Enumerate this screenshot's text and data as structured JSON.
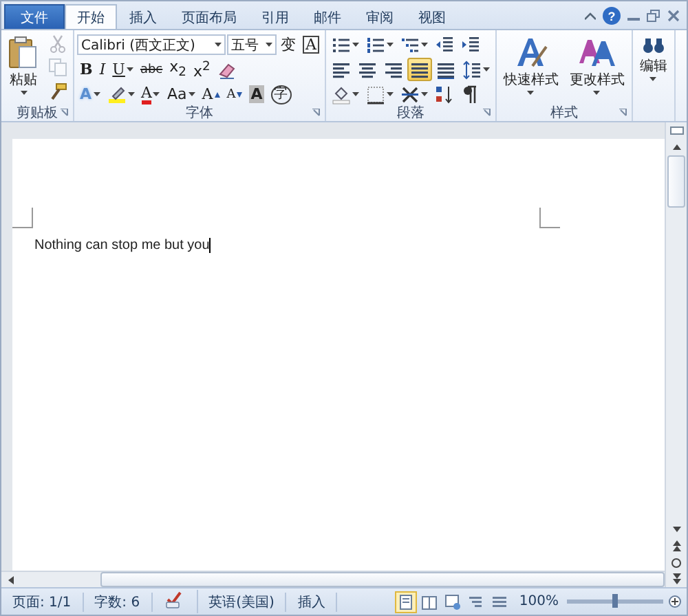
{
  "tabs": [
    {
      "label": "文件",
      "kind": "file",
      "selected": false
    },
    {
      "label": "开始",
      "kind": "tab",
      "selected": true
    },
    {
      "label": "插入",
      "kind": "tab",
      "selected": false
    },
    {
      "label": "页面布局",
      "kind": "tab",
      "selected": false
    },
    {
      "label": "引用",
      "kind": "tab",
      "selected": false
    },
    {
      "label": "邮件",
      "kind": "tab",
      "selected": false
    },
    {
      "label": "审阅",
      "kind": "tab",
      "selected": false
    },
    {
      "label": "视图",
      "kind": "tab",
      "selected": false
    }
  ],
  "help": "?",
  "ribbon": {
    "clipboard": {
      "label": "剪贴板",
      "paste": "粘贴",
      "tools": [
        {
          "kind": "cut",
          "disabled": true
        },
        {
          "kind": "copy",
          "disabled": true
        },
        {
          "kind": "painter",
          "disabled": false
        }
      ]
    },
    "font": {
      "label": "字体",
      "font_name": "Calibri (西文正文)",
      "font_size": "五号",
      "tool_rows": [
        {
          "tools": [
            {
              "kind": "phonetic",
              "text": "变"
            },
            {
              "kind": "border",
              "text": "A"
            }
          ]
        },
        {
          "tools": [
            {
              "kind": "bold",
              "text": "B"
            },
            {
              "kind": "italic",
              "text": "I"
            },
            {
              "kind": "underline",
              "text": "U"
            },
            {
              "kind": "strike",
              "text": "abc"
            },
            {
              "kind": "sub",
              "text": "x$_{2}$"
            },
            {
              "kind": "sup",
              "text": "x$^{2}$"
            },
            {
              "kind": "clear"
            }
          ]
        },
        {
          "tools": [
            {
              "kind": "effect",
              "text": "A"
            },
            {
              "kind": "highlight"
            },
            {
              "kind": "color",
              "text": "A"
            },
            {
              "kind": "case",
              "text": "Aa"
            },
            {
              "kind": "grow",
              "text": "A"
            },
            {
              "kind": "shrink",
              "text": "A"
            },
            {
              "kind": "shading",
              "text": "A"
            },
            {
              "kind": "enclose",
              "text": "字"
            }
          ]
        }
      ]
    },
    "paragraph": {
      "label": "段落",
      "tool_rows": [
        {
          "tools": [
            {
              "kind": "bullets"
            },
            {
              "kind": "numbering"
            },
            {
              "kind": "multilevel"
            },
            {
              "kind": "outdent"
            },
            {
              "kind": "indent"
            }
          ]
        },
        {
          "tools": [
            {
              "kind": "left",
              "selected": false
            },
            {
              "kind": "center",
              "selected": false
            },
            {
              "kind": "right",
              "selected": false
            },
            {
              "kind": "justify",
              "selected": true
            },
            {
              "kind": "distribute",
              "selected": false
            },
            {
              "kind": "spacing",
              "selected": false
            }
          ]
        },
        {
          "tools": [
            {
              "kind": "fill"
            },
            {
              "kind": "borders"
            },
            {
              "kind": "asian"
            },
            {
              "kind": "sort"
            },
            {
              "kind": "marks"
            }
          ]
        }
      ]
    },
    "styles": {
      "label": "样式",
      "buttons": [
        {
          "kind": "quick",
          "label": "快速样式"
        },
        {
          "kind": "change",
          "label": "更改样式"
        }
      ]
    },
    "editing": {
      "label": "编辑"
    }
  },
  "document": {
    "text": "Nothing can stop me but you"
  },
  "status_bar": {
    "items": [
      {
        "kind": "text",
        "text": "页面: 1/1"
      },
      {
        "kind": "text",
        "text": "字数: 6"
      },
      {
        "kind": "proofing"
      },
      {
        "kind": "text",
        "text": "英语(美国)"
      },
      {
        "kind": "text",
        "text": "插入"
      }
    ],
    "views": [
      {
        "kind": "print",
        "selected": true
      },
      {
        "kind": "reading",
        "selected": false
      },
      {
        "kind": "web",
        "selected": false
      },
      {
        "kind": "outline",
        "selected": false
      },
      {
        "kind": "draft",
        "selected": false
      }
    ],
    "zoom": "100%",
    "zoom_slider": {
      "level": 0.5
    }
  }
}
